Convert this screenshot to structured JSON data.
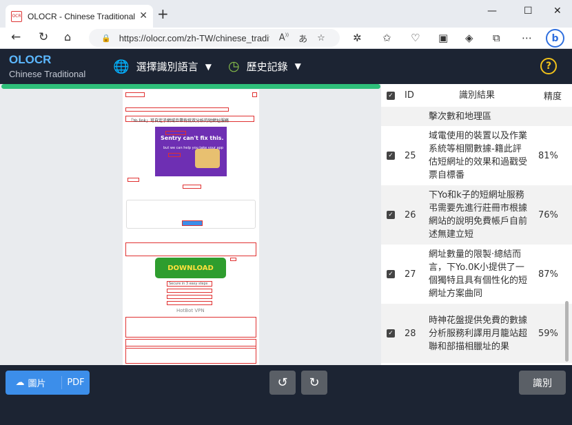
{
  "browser": {
    "tab_title": "OLOCR - Chinese Traditional OCR",
    "favicon_text": "OCR",
    "url": "https://olocr.com/zh-TW/chinese_traditional",
    "read_aloud_label": "Aₙ",
    "translate_label": "á"
  },
  "app": {
    "logo": "OLOCR",
    "logo_sub": "Chinese Traditional",
    "menu_language": "選擇識別語言",
    "menu_history": "歷史記錄",
    "help": "?"
  },
  "table": {
    "col_id": "ID",
    "col_result": "識別結果",
    "col_accuracy": "精度",
    "partial_text": "擊次數和地理區",
    "rows": [
      {
        "id": "25",
        "text": "域電使用的裝置以及作業系統等相關數據-籍此評估短網址的效果和過戳受票自標番",
        "accuracy": "81%"
      },
      {
        "id": "26",
        "text": "下Yo和k子的短網址服務弔需要先進行莊冊市根據網站的說明免費帳戶自前述無建立短",
        "accuracy": "76%"
      },
      {
        "id": "27",
        "text": "網址數量的限製·總結而言，下Yo.0K小提供了一個獨特且具有個性化的短網址方案曲同",
        "accuracy": "87%"
      },
      {
        "id": "28",
        "text": "時神花盤提供免費的數據分析服務利譯用月籠站超聯和部描相臘址的果",
        "accuracy": "59%"
      }
    ]
  },
  "preview": {
    "heading": "「Yo.link」可自定子網域且帶有統双分析的短網址服務",
    "ad_title": "Sentry can't fix this.",
    "ad_sub": "but we can help you take your app",
    "download": "DOWNLOAD",
    "secure": "Secure in 3 easy steps",
    "vpn": "HotBot VPN"
  },
  "toolbar": {
    "image_btn": "圖片",
    "pdf_btn": "PDF",
    "recognize_btn": "識別"
  },
  "colors": {
    "accent": "#3c8eea",
    "header_bg": "#1c2433",
    "progress": "#2ebf7a",
    "logo": "#5cb8ff"
  }
}
